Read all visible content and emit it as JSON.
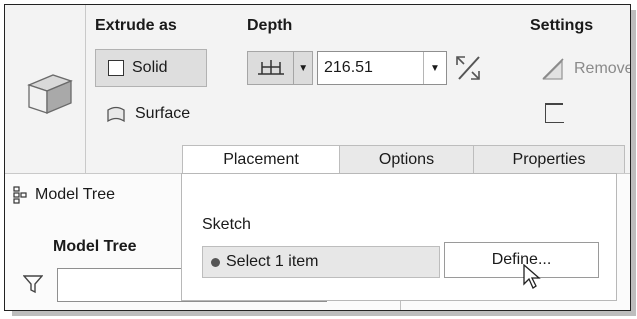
{
  "ribbon": {
    "extrude_as": {
      "title": "Extrude as",
      "solid_label": "Solid",
      "surface_label": "Surface"
    },
    "depth": {
      "title": "Depth",
      "value": "216.51"
    },
    "settings": {
      "title": "Settings",
      "remove_label": "Remove"
    }
  },
  "tabs": [
    {
      "label": "Placement",
      "active": true
    },
    {
      "label": "Options",
      "active": false
    },
    {
      "label": "Properties",
      "active": false
    }
  ],
  "model_tree": {
    "tab_label": "Model Tree",
    "title": "Model Tree",
    "filter_value": ""
  },
  "placement_panel": {
    "sketch_label": "Sketch",
    "collector_text": "Select 1 item",
    "define_label": "Define..."
  },
  "colors": {
    "frame_bg": "#f3f3f3",
    "pressed_bg": "#dedede",
    "border": "#222222"
  }
}
